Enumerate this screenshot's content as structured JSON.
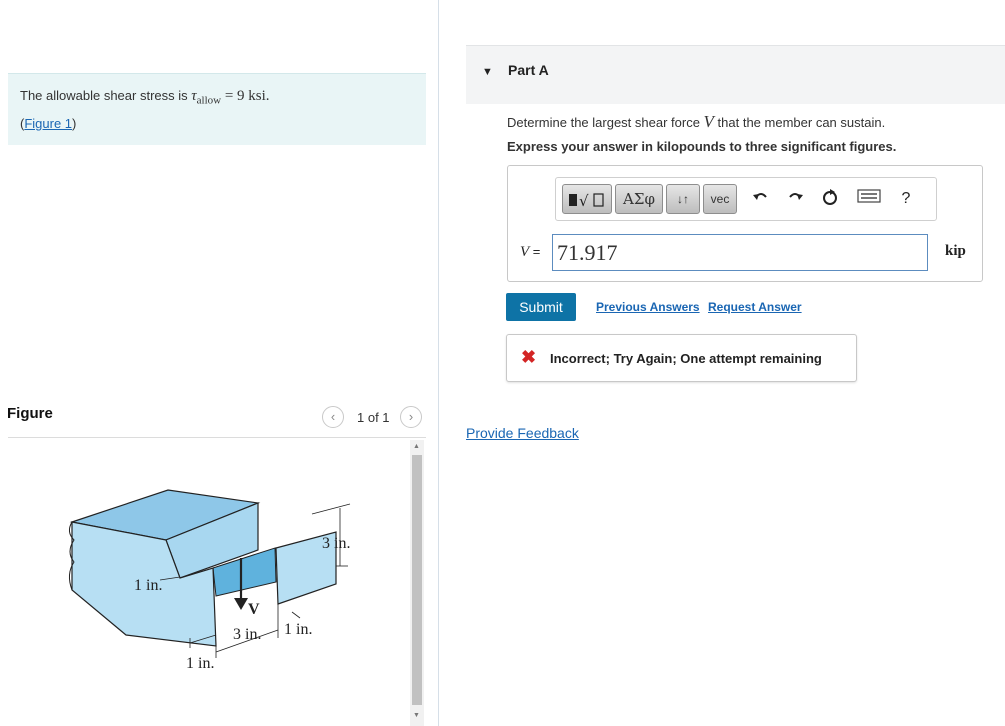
{
  "problem": {
    "text_before": "The allowable shear stress is ",
    "tau_symbol": "τ",
    "tau_subscript": "allow",
    "value": " = 9 ksi.",
    "figure_link_open": "(",
    "figure_link": "Figure 1",
    "figure_link_close": ")"
  },
  "figure_panel": {
    "heading": "Figure",
    "pager": {
      "prev_icon": "‹",
      "text": "1 of 1",
      "next_icon": "›"
    },
    "labels": {
      "top_depth": "3 in.",
      "left_thickness": "1 in.",
      "force": "V",
      "bottom_gap": "3 in.",
      "bottom_right": "1 in.",
      "bottom_left": "1 in."
    },
    "colors": {
      "top_face": "#8ec7e8",
      "front_face": "#b7dff3",
      "inner_face": "#5fb2dd",
      "edge": "#222222"
    }
  },
  "part": {
    "title": "Part A",
    "caret_icon": "▼",
    "question_before": "Determine the largest shear force ",
    "question_var": "V",
    "question_after": " that the member can sustain.",
    "instruction": "Express your answer in kilopounds to three significant figures.",
    "toolbar": {
      "templates_icon": "templates-icon",
      "greek_label": "ΑΣφ",
      "arrows_label": "↓↑",
      "vec_label": "vec",
      "undo_icon": "undo-icon",
      "redo_icon": "redo-icon",
      "reset_icon": "reset-icon",
      "keyboard_icon": "keyboard-icon",
      "help_label": "?"
    },
    "answer": {
      "variable": "V",
      "equals": " =",
      "value": "71.917",
      "unit": "kip"
    },
    "submit_label": "Submit",
    "previous_answers_label": "Previous Answers",
    "request_answer_label": "Request Answer",
    "feedback": {
      "icon": "x-icon",
      "text": "Incorrect; Try Again; One attempt remaining",
      "color": "#d32525"
    },
    "provide_feedback_label": "Provide Feedback"
  }
}
